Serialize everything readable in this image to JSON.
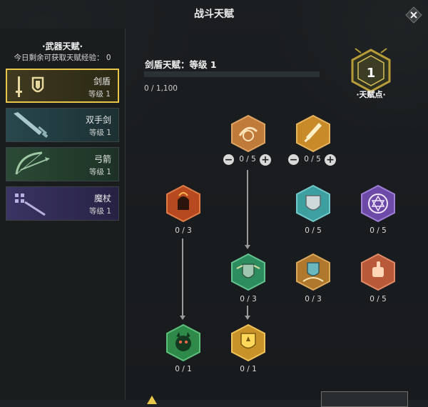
{
  "window": {
    "title": "战斗天赋"
  },
  "left": {
    "title": "·武器天赋·",
    "subtitle": "今日剩余可获取天赋经验：  0",
    "weapons": [
      {
        "name": "剑盾",
        "level": "等级 1",
        "selected": true,
        "icon": "sword-shield-icon"
      },
      {
        "name": "双手剑",
        "level": "等级 1",
        "selected": false,
        "icon": "greatsword-icon"
      },
      {
        "name": "弓箭",
        "level": "等级 1",
        "selected": false,
        "icon": "bow-icon"
      },
      {
        "name": "魔杖",
        "level": "等级 1",
        "selected": false,
        "icon": "wand-icon"
      }
    ]
  },
  "main": {
    "header": "剑盾天赋：等级 1",
    "xp_text": "0 / 1,100",
    "xp_progress": 0.0,
    "talent_points": {
      "value": "1",
      "label": "·天赋点·"
    }
  },
  "talents": [
    {
      "id": "t1",
      "progress": "0 / 5",
      "icon": "shield-swirl-icon",
      "color": "#c07a3a",
      "controls": true
    },
    {
      "id": "t2",
      "progress": "0 / 5",
      "icon": "sword-icon",
      "color": "#c98a2a",
      "controls": true
    },
    {
      "id": "t3",
      "progress": "0 / 3",
      "icon": "fire-fist-icon",
      "color": "#b6491f"
    },
    {
      "id": "t4",
      "progress": "0 / 5",
      "icon": "shield-icon",
      "color": "#3d9fa0"
    },
    {
      "id": "t5",
      "progress": "0 / 5",
      "icon": "magic-circle-icon",
      "color": "#6d4aa8"
    },
    {
      "id": "t6",
      "progress": "0 / 3",
      "icon": "shield-wings-icon",
      "color": "#2e8d5e"
    },
    {
      "id": "t7",
      "progress": "0 / 3",
      "icon": "shield-storm-icon",
      "color": "#b0782d"
    },
    {
      "id": "t8",
      "progress": "0 / 5",
      "icon": "fist-strike-icon",
      "color": "#b85a3a"
    },
    {
      "id": "t9",
      "progress": "0 / 1",
      "icon": "beast-icon",
      "color": "#2f8a4a"
    },
    {
      "id": "t10",
      "progress": "0 / 1",
      "icon": "golden-shield-icon",
      "color": "#c79328"
    }
  ],
  "colors": {
    "accent": "#e8c64a",
    "panel": "#1a1d1f"
  }
}
